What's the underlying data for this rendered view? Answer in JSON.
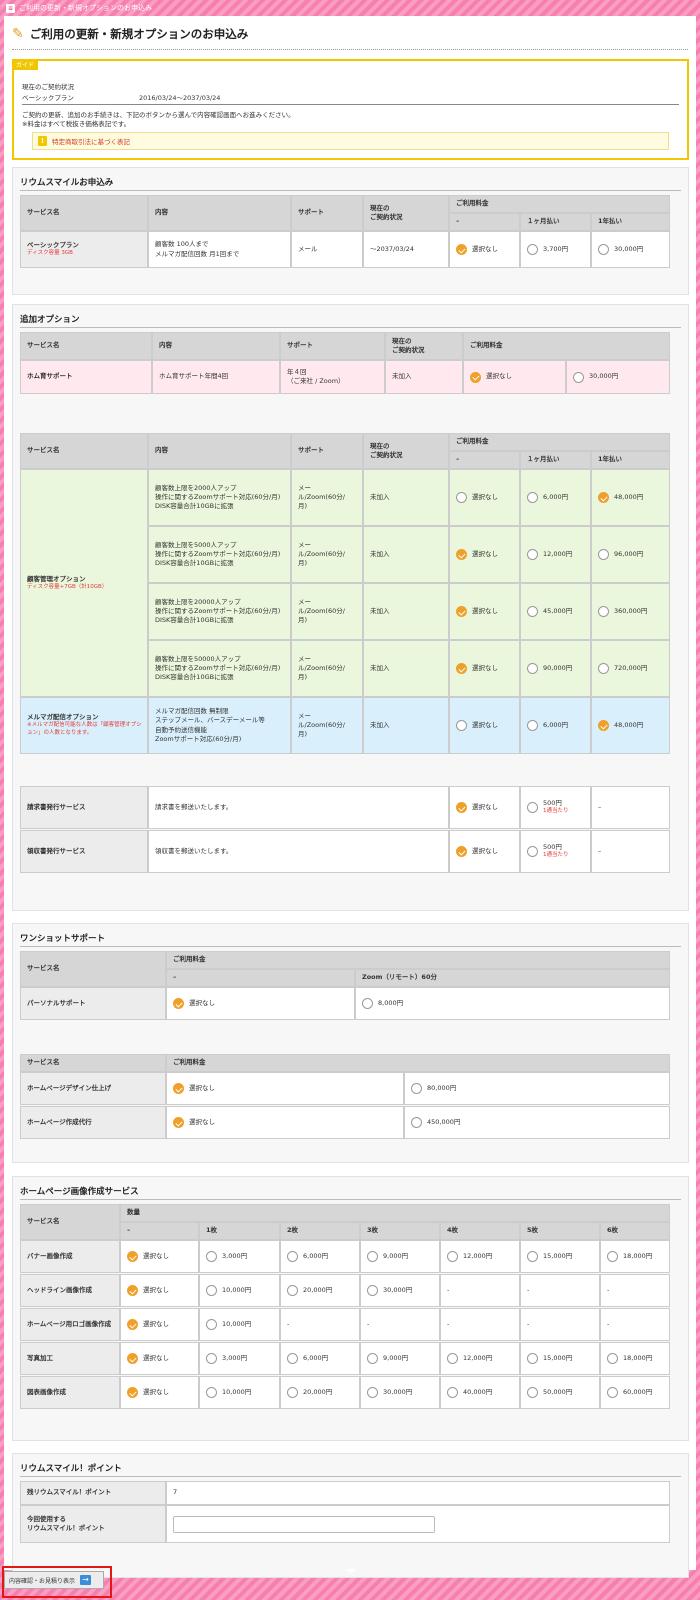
{
  "window": {
    "title": "ご利用の更新・新規オプションのお申込み",
    "icon": "app-icon"
  },
  "page": {
    "title": "ご利用の更新・新規オプションのお申込み"
  },
  "guide": {
    "tag": "ガイド",
    "status_label": "現在のご契約状況",
    "plan_name": "ベーシックプラン",
    "plan_period": "2016/03/24〜2037/03/24",
    "note1": "ご契約の更新、追加のお手続きは、下記のボタンから選んで内容確認画面へお進みください。",
    "note2": "※料金はすべて税抜き価格表記です。",
    "law_link": "特定商取引法に基づく表記"
  },
  "h": {
    "service": "サービス名",
    "content": "内容",
    "support": "サポート",
    "status": "現在の\nご契約状況",
    "fee": "ご利用料金",
    "none": "–",
    "monthly": "１ヶ月払い",
    "yearly": "1年払い",
    "select_none": "選択なし",
    "qty": "数量"
  },
  "sec1": {
    "title": "リウムスマイルお申込み",
    "row": {
      "name": "ベーシックプラン",
      "sub": "ディスク容量 3GB",
      "content": "顧客数 100人まで\nメルマガ配信回数 月1回まで",
      "support": "メール",
      "status": "〜2037/03/24",
      "monthly": "3,700円",
      "yearly": "30,000円",
      "selected": 0
    }
  },
  "sec2": {
    "title": "追加オプション",
    "hom": {
      "name": "ホム育サポート",
      "content": "ホム育サポート年間4回",
      "support": "年４回\n（ご来社 / Zoom）",
      "status": "未加入",
      "yearly": "30,000円",
      "selected": 0
    },
    "crm_name": "顧客管理オプション",
    "crm_sub": "ディスク容量+7GB（計10GB）",
    "crm": [
      {
        "content": "顧客数上限を2000人アップ\n操作に関するZoomサポート対応(60分/月)\nDISK容量合計10GBに拡張",
        "support": "メー\nル/Zoom(60分/\n月)",
        "status": "未加入",
        "monthly": "6,000円",
        "yearly": "48,000円",
        "selected": 2
      },
      {
        "content": "顧客数上限を5000人アップ\n操作に関するZoomサポート対応(60分/月)\nDISK容量合計10GBに拡張",
        "support": "メー\nル/Zoom(60分/\n月)",
        "status": "未加入",
        "monthly": "12,000円",
        "yearly": "96,000円",
        "selected": 0
      },
      {
        "content": "顧客数上限を20000人アップ\n操作に関するZoomサポート対応(60分/月)\nDISK容量合計10GBに拡張",
        "support": "メー\nル/Zoom(60分/\n月)",
        "status": "未加入",
        "monthly": "45,000円",
        "yearly": "360,000円",
        "selected": 0
      },
      {
        "content": "顧客数上限を50000人アップ\n操作に関するZoomサポート対応(60分/月)\nDISK容量合計10GBに拡張",
        "support": "メー\nル/Zoom(60分/\n月)",
        "status": "未加入",
        "monthly": "90,000円",
        "yearly": "720,000円",
        "selected": 0
      }
    ],
    "mail": {
      "name": "メルマガ配信オプション",
      "sub": "※メルマガ配信可能な人数は「顧客管理オプション」の人数となります。",
      "content": "メルマガ配信回数 無制限\nステップメール、バースデーメール等\n自動予約送信機能\nZoomサポート対応(60分/月)",
      "support": "メー\nル/Zoom(60分/\n月)",
      "status": "未加入",
      "monthly": "6,000円",
      "yearly": "48,000円",
      "selected": 2
    },
    "invoice": {
      "name": "請求書発行サービス",
      "content": "請求書を郵送いたします。",
      "price": "500円",
      "per": "1通当たり",
      "dash": "–",
      "selected": 0
    },
    "receipt": {
      "name": "領収書発行サービス",
      "content": "領収書を郵送いたします。",
      "price": "500円",
      "per": "1通当たり",
      "dash": "–",
      "selected": 0
    }
  },
  "sec3": {
    "title": "ワンショットサポート",
    "zoom_head": "Zoom（リモート）60分",
    "personal": {
      "name": "パーソナルサポート",
      "price": "8,000円",
      "selected": 0
    },
    "hp_design": {
      "name": "ホームページデザイン仕上げ",
      "price": "80,000円",
      "selected": 0
    },
    "hp_make": {
      "name": "ホームページ作成代行",
      "price": "450,000円",
      "selected": 0
    }
  },
  "sec4": {
    "title": "ホームページ画像作成サービス",
    "cols": [
      "–",
      "1枚",
      "2枚",
      "3枚",
      "4枚",
      "5枚",
      "6枚"
    ],
    "rows": [
      {
        "name": "バナー画像作成",
        "prices": [
          "3,000円",
          "6,000円",
          "9,000円",
          "12,000円",
          "15,000円",
          "18,000円"
        ]
      },
      {
        "name": "ヘッドライン画像作成",
        "prices": [
          "10,000円",
          "20,000円",
          "30,000円",
          "-",
          "-",
          "-"
        ]
      },
      {
        "name": "ホームページ用ロゴ画像作成",
        "prices": [
          "10,000円",
          "-",
          "-",
          "-",
          "-",
          "-"
        ]
      },
      {
        "name": "写真加工",
        "prices": [
          "3,000円",
          "6,000円",
          "9,000円",
          "12,000円",
          "15,000円",
          "18,000円"
        ]
      },
      {
        "name": "図表画像作成",
        "prices": [
          "10,000円",
          "20,000円",
          "30,000円",
          "40,000円",
          "50,000円",
          "60,000円"
        ]
      }
    ]
  },
  "sec5": {
    "title": "リウムスマイル！ポイント",
    "remain_label": "残リウムスマイル！ポイント",
    "remain_value": "7",
    "use_label": "今回使用する\nリウムスマイル！ポイント",
    "use_value": ""
  },
  "footer": {
    "confirm_label": "内容確認・お見積り表示"
  },
  "colors": {
    "accent": "#efa02a",
    "pink_bg": "#f77fb0",
    "guide_border": "#f2c700"
  }
}
